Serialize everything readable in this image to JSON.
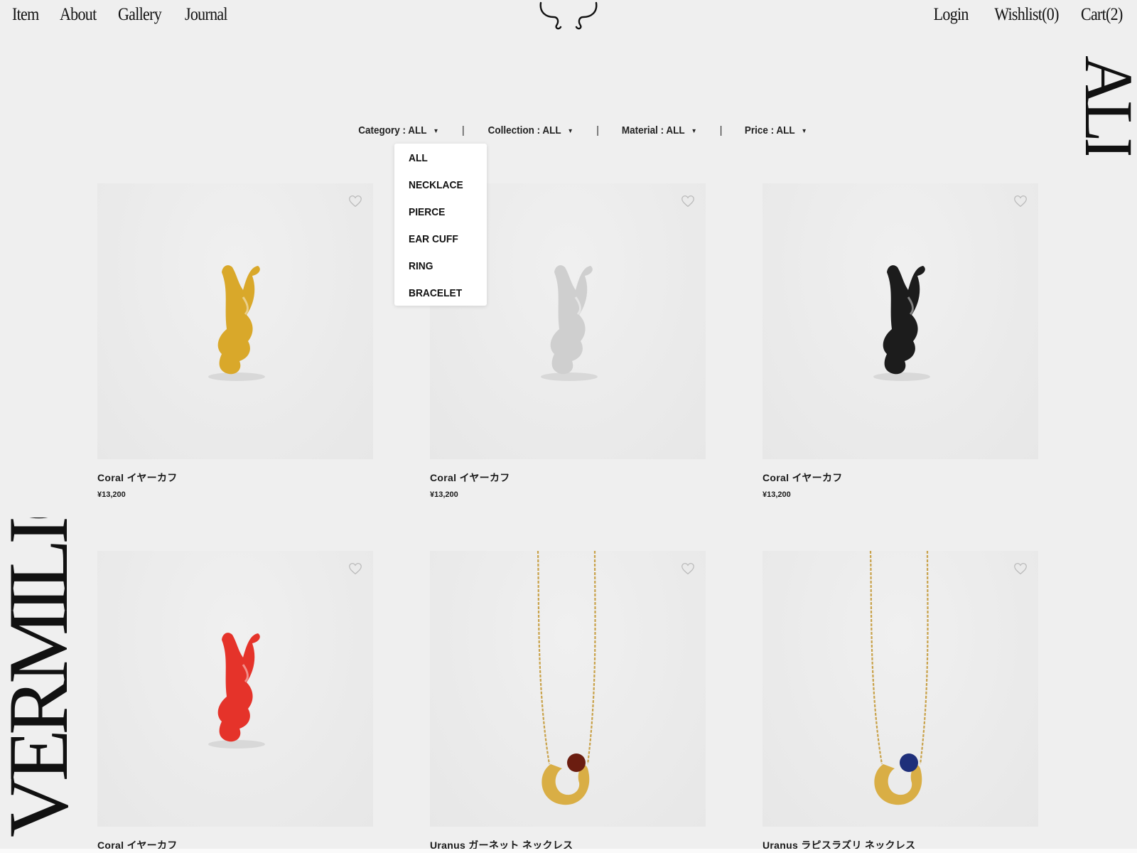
{
  "header": {
    "nav_left": [
      "Item",
      "About",
      "Gallery",
      "Journal"
    ],
    "login": "Login",
    "wishlist": "Wishlist(0)",
    "cart": "Cart(2)"
  },
  "page": {
    "vertical_title": "ALL",
    "brand_vertical": "VERMILION"
  },
  "filters": {
    "category": "Category : ALL",
    "collection": "Collection : ALL",
    "material": "Material : ALL",
    "price": "Price : ALL",
    "separator": "|"
  },
  "category_dropdown": [
    "ALL",
    "NECKLACE",
    "PIERCE",
    "EAR CUFF",
    "RING",
    "BRACELET"
  ],
  "products": [
    {
      "name": "Coral イヤーカフ",
      "price": "¥13,200",
      "image": "gold-coral-ear-cuff",
      "color": "#d9a82a"
    },
    {
      "name": "Coral イヤーカフ",
      "price": "¥13,200",
      "image": "silver-coral-ear-cuff",
      "color": "#cfcfcf"
    },
    {
      "name": "Coral イヤーカフ",
      "price": "¥13,200",
      "image": "black-coral-ear-cuff",
      "color": "#1c1c1c"
    },
    {
      "name": "Coral イヤーカフ",
      "price": "",
      "image": "red-coral-ear-cuff",
      "color": "#e5332a"
    },
    {
      "name": "Uranus ガーネット ネックレス",
      "price": "",
      "image": "garnet-necklace",
      "color": "#6b1d10"
    },
    {
      "name": "Uranus ラピスラズリ ネックレス",
      "price": "",
      "image": "lapis-necklace",
      "color": "#1f2f7a"
    }
  ],
  "icons": {
    "wishlist_heart": "heart-icon",
    "caret": "caret-down-icon",
    "logo": "horns-logo"
  }
}
